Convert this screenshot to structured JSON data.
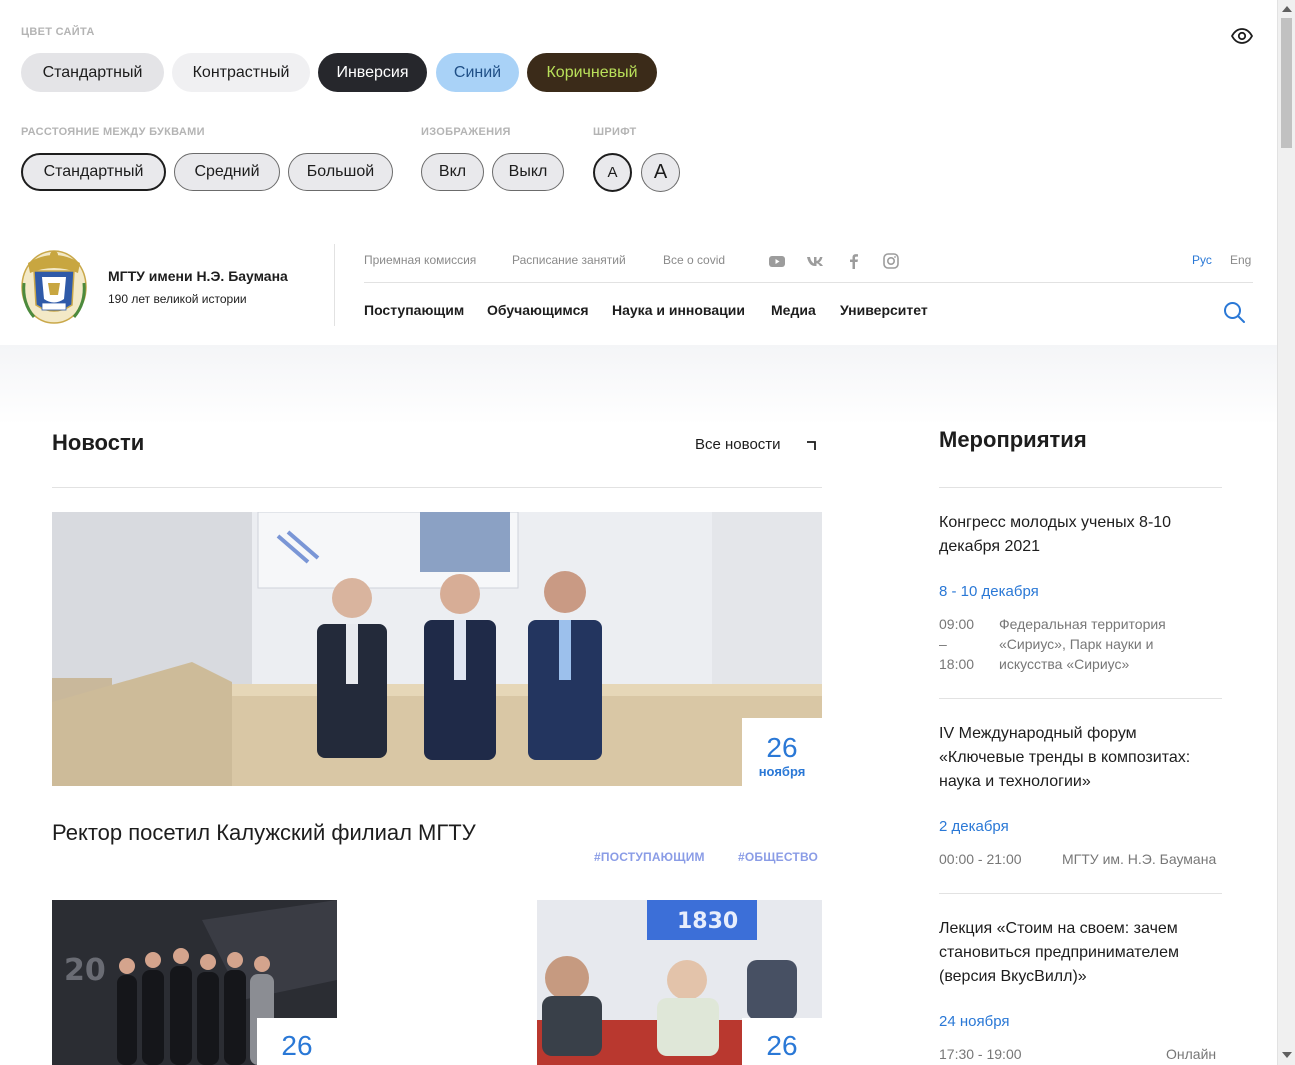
{
  "a11y": {
    "site_color_label": "ЦВЕТ САЙТА",
    "colors": [
      "Стандартный",
      "Контрастный",
      "Инверсия",
      "Синий",
      "Коричневый"
    ],
    "spacing_label": "РАССТОЯНИЕ МЕЖДУ БУКВАМИ",
    "spacing": [
      "Стандартный",
      "Средний",
      "Большой"
    ],
    "images_label": "ИЗОБРАЖЕНИЯ",
    "images": [
      "Вкл",
      "Выкл"
    ],
    "font_label": "ШРИФТ",
    "font": [
      "А",
      "А"
    ]
  },
  "header": {
    "brand_title": "МГТУ имени Н.Э. Баумана",
    "brand_sub": "190 лет великой истории",
    "top_links": [
      "Приемная комиссия",
      "Расписание занятий",
      "Все о covid"
    ],
    "lang_active": "Рус",
    "lang_other": "Eng",
    "nav": [
      "Поступающим",
      "Обучающимся",
      "Наука и инновации",
      "Медиа",
      "Университет"
    ]
  },
  "news": {
    "heading": "Новости",
    "all_link": "Все новости",
    "featured": {
      "day": "26",
      "month": "ноября",
      "title": "Ректор посетил Калужский филиал МГТУ",
      "tags": [
        "#ПОСТУПАЮЩИМ",
        "#ОБЩЕСТВО"
      ]
    },
    "cards": [
      {
        "day": "26"
      },
      {
        "day": "26"
      }
    ]
  },
  "events": {
    "heading": "Мероприятия",
    "items": [
      {
        "title": "Конгресс молодых ученых 8-10 декабря 2021",
        "date": "8 - 10 декабря",
        "time_start": "09:00",
        "time_sep": "–",
        "time_end": "18:00",
        "place": "Федеральная территория «Сириус», Парк науки и искусства «Сириус»"
      },
      {
        "title": "IV Международный форум «Ключевые тренды в композитах: наука и технологии»",
        "date": "2 декабря",
        "time": "00:00 - 21:00",
        "place": "МГТУ им. Н.Э. Баумана"
      },
      {
        "title": "Лекция «Стоим на своем: зачем становиться предпринимателем (версия ВкусВилл)»",
        "date": "24 ноября",
        "time": "17:30 - 19:00",
        "place": "Онлайн"
      }
    ]
  },
  "colors": {
    "accent_blue": "#2a78d6",
    "tag_color": "#8a9ce6",
    "brown_pill_text": "#b9e05a"
  }
}
